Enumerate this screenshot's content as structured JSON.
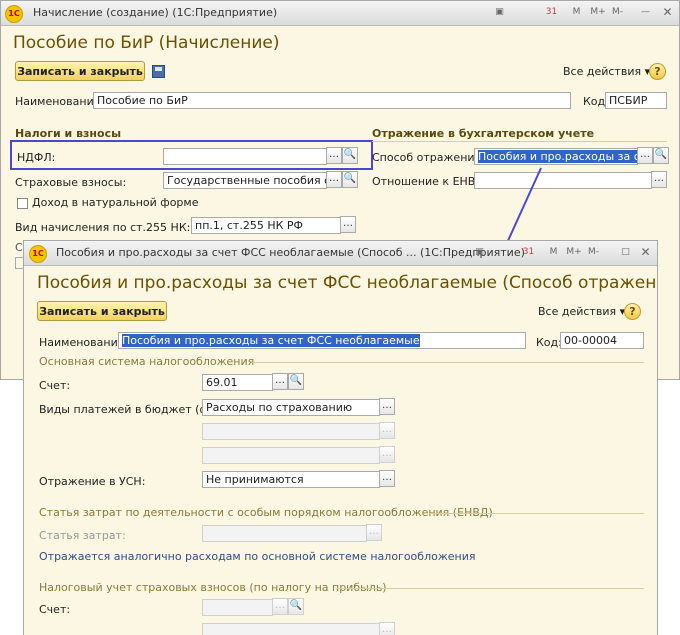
{
  "win1": {
    "title": "Начисление (создание)  (1С:Предприятие)",
    "tb": [
      "M",
      "M+",
      "M-"
    ],
    "header": "Пособие по БиР (Начисление)",
    "save": "Записать и закрыть",
    "actions": "Все действия ▾",
    "help": "?",
    "name_label": "Наименование:",
    "name_value": "Пособие по БиР",
    "code_label": "Код:",
    "code_value": "ПСБИР",
    "taxes_header": "Налоги и взносы",
    "ndfl_label": "НДФЛ:",
    "ndfl_value": "",
    "ins_label": "Страховые взносы:",
    "ins_value": "Государственные пособия обяз",
    "natural_label": "Доход в натуральной форме",
    "vid_label": "Вид начисления по ст.255 НК:",
    "vid_value": "пп.1, ст.255 НК РФ",
    "acc_header": "Отражение в бухгалтерском учете",
    "method_label": "Способ отражения:",
    "method_value": "Пособия и про.расходы за счет",
    "envd_label": "Отношение к ЕНВД:",
    "envd_value": ""
  },
  "win2": {
    "title": "Пособия и про.расходы за счет ФСС необлагаемые (Способ ...  (1С:Предприятие)",
    "tb": [
      "M",
      "M+",
      "M-"
    ],
    "header": "Пособия и про.расходы за счет ФСС необлагаемые (Способ отражения з...",
    "save": "Записать и закрыть",
    "actions": "Все действия ▾",
    "help": "?",
    "name_label": "Наименование:",
    "name_value": "Пособия и про.расходы за счет ФСС необлагаемые",
    "code_label": "Код:",
    "code_value": "00-00004",
    "main_section": "Основная система налогообложения",
    "account_label": "Счет:",
    "account_value": "69.01",
    "payments_label": "Виды платежей в бюджет (фо...",
    "payments_value": "Расходы по страхованию",
    "usn_label": "Отражение в УСН:",
    "usn_value": "Не принимаются",
    "envd_section": "Статья затрат по деятельности с особым порядком налогообложения (ЕНВД)",
    "cost_label": "Статья затрат:",
    "envd_note": "Отражается аналогично расходам по основной системе налогообложения",
    "ins_section": "Налоговый учет страховых взносов (по налогу на прибыль)",
    "account2_label": "Счет:"
  }
}
